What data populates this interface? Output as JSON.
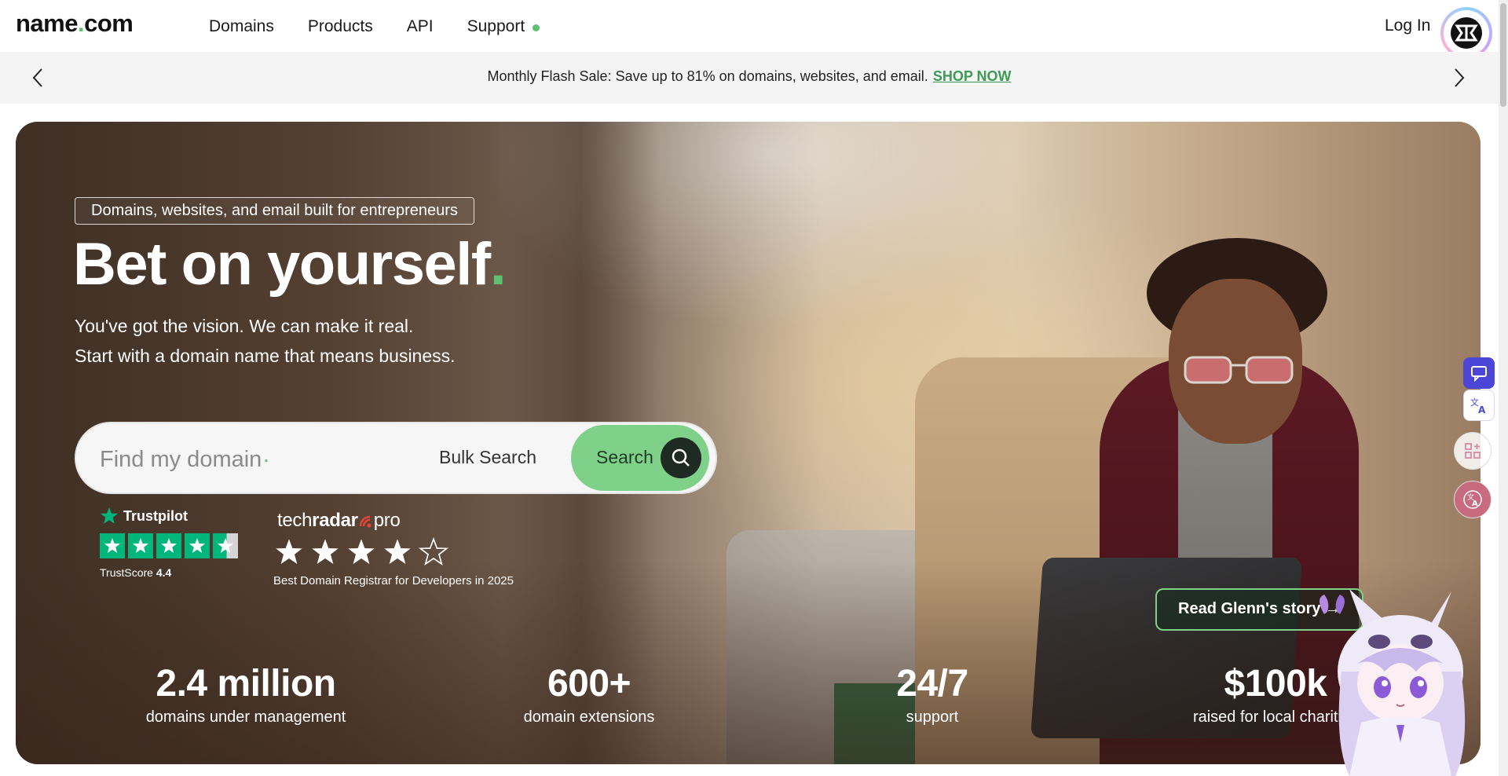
{
  "nav": {
    "logo_left": "name",
    "logo_dot": ".",
    "logo_right": "com",
    "links": [
      "Domains",
      "Products",
      "API",
      "Support"
    ],
    "login": "Log In"
  },
  "promo": {
    "text": "Monthly Flash Sale: Save up to 81% on domains, websites, and email.",
    "link": "SHOP NOW"
  },
  "hero": {
    "tagline": "Domains, websites, and email built for entrepreneurs",
    "headline": "Bet on yourself",
    "headline_dot": ".",
    "subline_1": "You've got the vision. We can make it real.",
    "subline_2": "Start with a domain name that means business.",
    "search_placeholder": "Find my domain",
    "search_dot": ".",
    "bulk_search": "Bulk Search",
    "search_button": "Search",
    "cta": "Read Glenn's story →"
  },
  "ratings": {
    "trustpilot_name": "Trustpilot",
    "trustpilot_label": "TrustScore",
    "trustpilot_score": "4.4",
    "trustpilot_stars": 4.5,
    "techradar_brand_light": "tech",
    "techradar_brand_bold": "radar",
    "techradar_brand_suffix": "pro",
    "techradar_stars": 4,
    "techradar_caption": "Best Domain Registrar for Developers in 2025"
  },
  "stats": [
    {
      "value": "2.4 million",
      "label": "domains under management"
    },
    {
      "value": "600+",
      "label": "domain extensions"
    },
    {
      "value": "24/7",
      "label": "support"
    },
    {
      "value": "$100k",
      "label": "raised for local charities"
    }
  ],
  "colors": {
    "accent_green": "#5fbf74",
    "search_button_green": "#7fd18a",
    "promo_link_green": "#3e9b55"
  }
}
